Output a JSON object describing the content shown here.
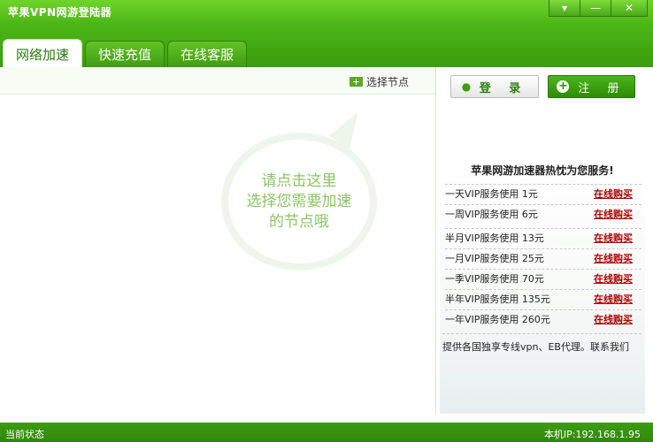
{
  "window": {
    "title": "苹果VPN网游登陆器",
    "controls": [
      "▾",
      "—",
      "✕"
    ]
  },
  "tabs": [
    {
      "label": "网络加速",
      "active": true
    },
    {
      "label": "快速充值",
      "active": false
    },
    {
      "label": "在线客服",
      "active": false
    }
  ],
  "left_panel": {
    "select_node_label": "选择节点",
    "hint_lines": [
      "请点击这里",
      "选择您需要加速",
      "的节点哦"
    ]
  },
  "auth": {
    "login_label": "登 录",
    "register_label": "注 册"
  },
  "promo": {
    "title": "苹果网游加速器热忱为您服务!",
    "items": [
      {
        "text": "一天VIP服务使用  1元",
        "link": "在线购买"
      },
      {
        "text": "一周VIP服务使用  6元",
        "link": "在线购买"
      },
      {
        "text": "半月VIP服务使用  13元",
        "link": "在线购买"
      },
      {
        "text": "一月VIP服务使用  25元",
        "link": "在线购买"
      },
      {
        "text": "一季VIP服务使用  70元",
        "link": "在线购买"
      },
      {
        "text": "半年VIP服务使用  135元",
        "link": "在线购买"
      },
      {
        "text": "一年VIP服务使用  260元",
        "link": "在线购买"
      }
    ],
    "footer": "提供各国独享专线vpn、EB代理。联系我们"
  },
  "status": {
    "left": "当前状态",
    "right": "本机IP:192.168.1.95"
  },
  "colors": {
    "brand_green": "#3f9e16",
    "buy_link": "#b00000",
    "hint_text": "#8cc565"
  }
}
